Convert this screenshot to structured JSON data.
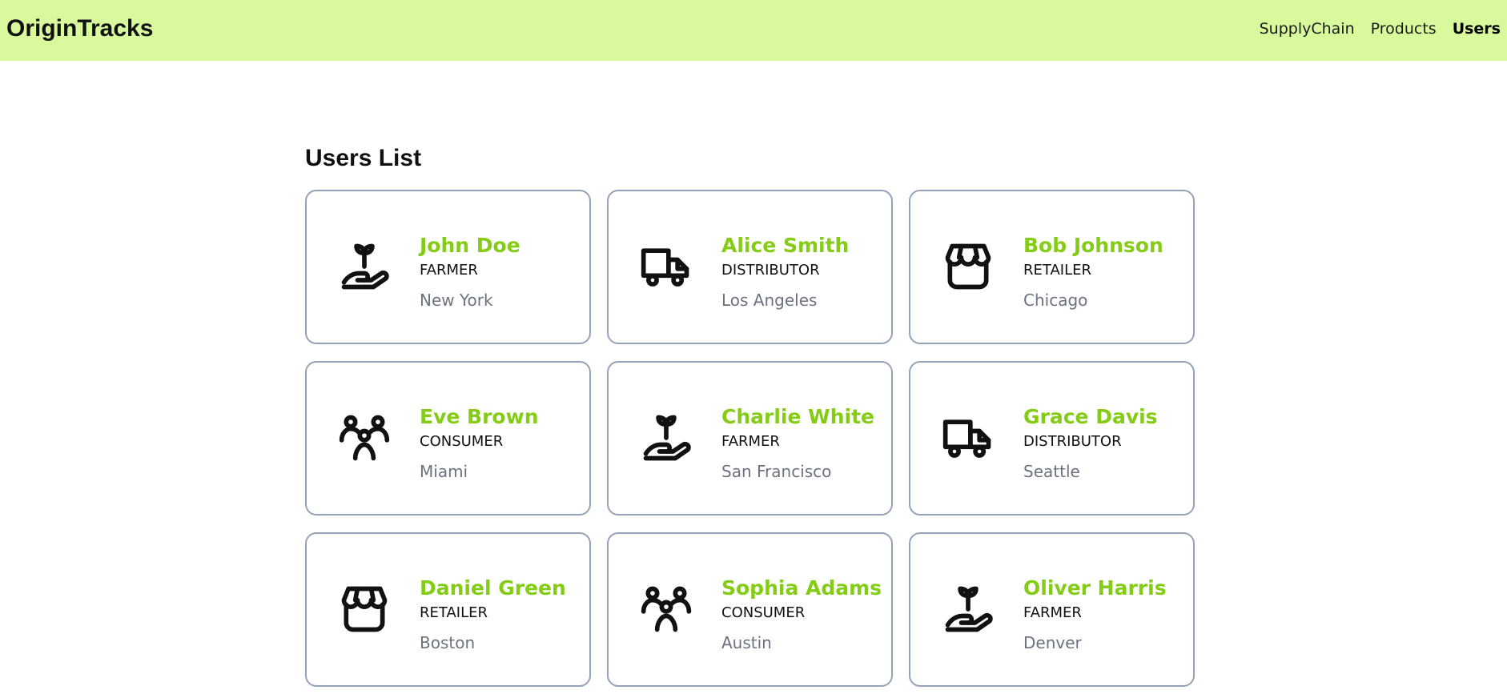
{
  "header": {
    "brand": "OriginTracks",
    "nav": [
      "SupplyChain",
      "Products",
      "Users"
    ],
    "active_nav": "Users",
    "background_color": "#d9f99d"
  },
  "main": {
    "title": "Users List",
    "users": [
      {
        "name": "John Doe",
        "role": "FARMER",
        "city": "New York",
        "icon": "plant-in-hand-icon"
      },
      {
        "name": "Alice Smith",
        "role": "DISTRIBUTOR",
        "city": "Los Angeles",
        "icon": "truck-icon"
      },
      {
        "name": "Bob Johnson",
        "role": "RETAILER",
        "city": "Chicago",
        "icon": "storefront-icon"
      },
      {
        "name": "Eve Brown",
        "role": "CONSUMER",
        "city": "Miami",
        "icon": "users-group-icon"
      },
      {
        "name": "Charlie White",
        "role": "FARMER",
        "city": "San Francisco",
        "icon": "plant-in-hand-icon"
      },
      {
        "name": "Grace Davis",
        "role": "DISTRIBUTOR",
        "city": "Seattle",
        "icon": "truck-icon"
      },
      {
        "name": "Daniel Green",
        "role": "RETAILER",
        "city": "Boston",
        "icon": "storefront-icon"
      },
      {
        "name": "Sophia Adams",
        "role": "CONSUMER",
        "city": "Austin",
        "icon": "users-group-icon"
      },
      {
        "name": "Oliver Harris",
        "role": "FARMER",
        "city": "Denver",
        "icon": "plant-in-hand-icon"
      }
    ],
    "name_color": "#84cc16",
    "city_color": "#6b7280",
    "card_border_color": "#94a3b8"
  }
}
